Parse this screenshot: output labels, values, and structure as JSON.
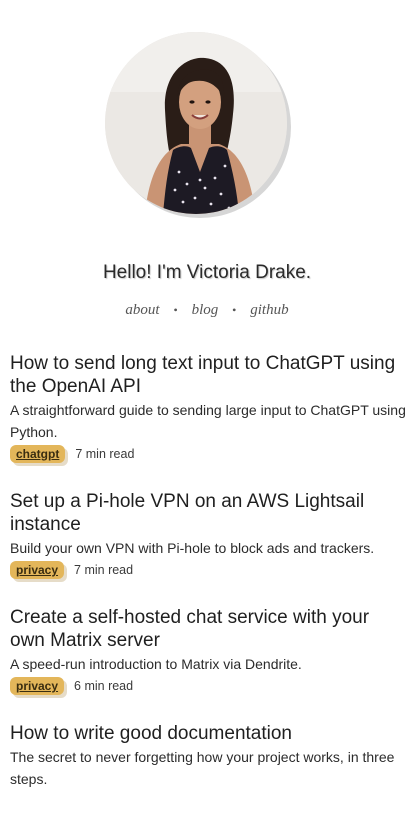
{
  "profile": {
    "greeting": "Hello! I'm Victoria Drake."
  },
  "nav": {
    "items": [
      "about",
      "blog",
      "github"
    ],
    "separator": "•"
  },
  "posts": [
    {
      "title": "How to send long text input to ChatGPT using the OpenAI API",
      "description": "A straightforward guide to sending large input to ChatGPT using Python.",
      "tag": "chatgpt",
      "read_time": "7 min read"
    },
    {
      "title": "Set up a Pi-hole VPN on an AWS Lightsail instance",
      "description": "Build your own VPN with Pi-hole to block ads and trackers.",
      "tag": "privacy",
      "read_time": "7 min read"
    },
    {
      "title": "Create a self-hosted chat service with your own Matrix server",
      "description": "A speed-run introduction to Matrix via Dendrite.",
      "tag": "privacy",
      "read_time": "6 min read"
    },
    {
      "title": "How to write good documentation",
      "description": "The secret to never forgetting how your project works, in three steps."
    }
  ],
  "colors": {
    "tag_background": "#e3b65a",
    "text": "#1f1f1f",
    "nav_text": "#555555"
  }
}
